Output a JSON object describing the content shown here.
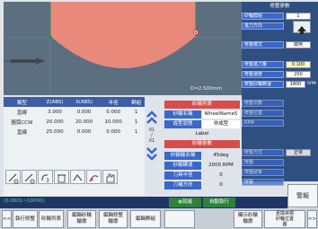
{
  "canvas": {
    "dimension_label": "D=2.500mm"
  },
  "table": {
    "headers": [
      "類型",
      "Z(ABS)",
      "X(ABS)",
      "半徑",
      "群組"
    ],
    "rows": [
      [
        "直線",
        "3.000",
        "0.000",
        "0.000",
        "1"
      ],
      [
        "圓弧CCW",
        "20.000",
        "20.000",
        "10.000",
        "1"
      ],
      [
        "直線",
        "25.000",
        "0.000",
        "0.000",
        "1"
      ]
    ]
  },
  "page_indicator": {
    "current": "01",
    "slash": "/",
    "total": "01"
  },
  "wheel_params": {
    "title_list": "砂輪列表",
    "name_label": "砂輪名稱",
    "name_value": "WheelName5",
    "shape_label": "成型狀態",
    "shape_value": "非成型",
    "label_text": "Label",
    "title_param": "砂輪參數"
  },
  "wheel_details": [
    {
      "label": "砂輪輪名稱",
      "value": "45deg"
    },
    {
      "label": "砂輪轉速",
      "value": "2000 RPM"
    },
    {
      "label": "刀具半徑",
      "value": "0"
    },
    {
      "label": "刀補方向",
      "value": "0"
    }
  ],
  "right_panel": {
    "title": "修整參數",
    "rows": [
      {
        "label": "砂輪群組",
        "value": "1"
      },
      {
        "label": "進刀方向",
        "value": "↑"
      },
      {
        "label": "修整模式",
        "value": "啟用"
      },
      {
        "label": "修整進刀量",
        "value": "0.100"
      },
      {
        "label": "修整速度",
        "value": "200"
      },
      {
        "label": "修整砂輪轉速",
        "value": "1800",
        "unit": "RPM"
      },
      {
        "label": "修整次數",
        "value": ""
      },
      {
        "label": "修整位置",
        "value": ""
      },
      {
        "label": "RPM",
        "value": ""
      },
      {
        "label": "修整方式",
        "value": "正常"
      },
      {
        "label": "修整",
        "value": ""
      },
      {
        "label": "修整結束",
        "value": ""
      },
      {
        "label": "修整",
        "value": ""
      }
    ],
    "warning_label": "警報"
  },
  "status": {
    "range": "(0.0001~10000)",
    "run_label": "就緒",
    "auto_label": "自動執行"
  },
  "tool_icons": [
    "add-icon",
    "edit-icon",
    "rotate-icon",
    "delete-icon",
    "convert-icon",
    "pointer-icon",
    "hand-icon"
  ],
  "bottom_bar": {
    "prev": "<<",
    "buttons": [
      "執行修整",
      "砂輪列表",
      "編輯砂輪\n輪廓",
      "編輯修整\n輪廓",
      "編輯群組",
      "",
      "顯示砂輪\n輪廓",
      "更換目標\n砂輪位置\n圖"
    ],
    "next": ">>"
  },
  "colors": {
    "panel": "#2f4f80",
    "canvas": "#5b6f80",
    "shape": "#e8897c",
    "accent": "#3b67c8"
  }
}
